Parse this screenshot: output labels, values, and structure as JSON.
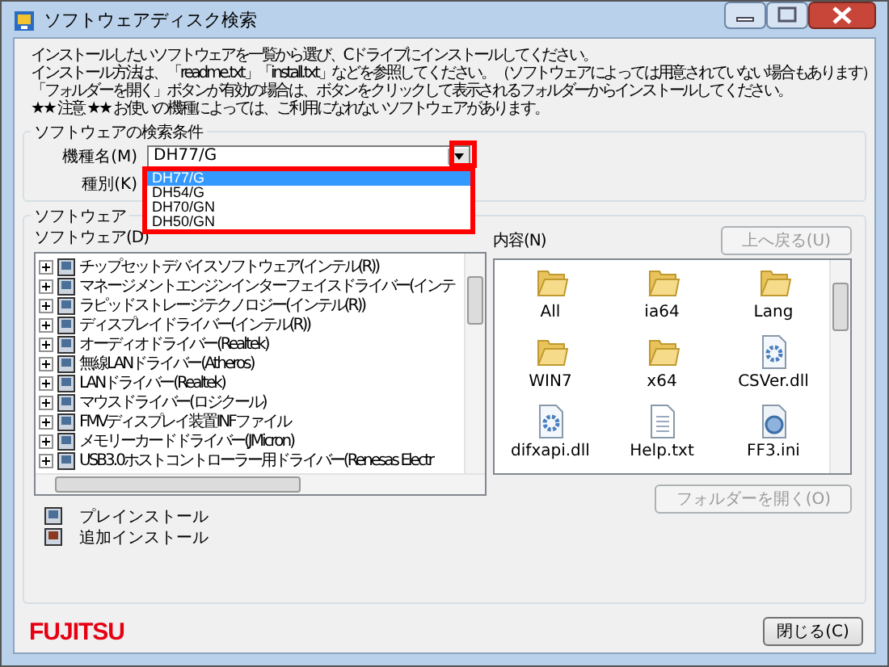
{
  "window": {
    "title": "ソフトウェアディスク検索"
  },
  "instructions": [
    "インストールしたいソフトウェアを一覧から選び、Cドライブにインストールしてください。",
    "インストール方法は、「readme.txt」「install.txt」などを参照してください。（ソフトウェアによっては用意されていない場合もあります）",
    "「フォルダーを開く」ボタンが有効の場合は、ボタンをクリックして表示されるフォルダーからインストールしてください。",
    "★★ 注意 ★★ お使いの機種によっては、ご利用になれないソフトウェアがあります。"
  ],
  "search_conditions": {
    "title": "ソフトウェアの検索条件",
    "model": {
      "label": "機種名(M)",
      "value": "DH77/G",
      "expanded": true,
      "options": [
        {
          "label": "DH77/G",
          "selected": true
        },
        {
          "label": "DH54/G",
          "selected": false
        },
        {
          "label": "DH70/GN",
          "selected": false
        },
        {
          "label": "DH50/GN",
          "selected": false
        }
      ]
    },
    "type": {
      "label": "種別(K)"
    }
  },
  "software": {
    "title": "ソフトウェア",
    "tree": {
      "label": "ソフトウェア(D)",
      "items": [
        {
          "label": "チップセットデバイスソフトウェア(インテル(R))",
          "expanded": false
        },
        {
          "label": "マネージメントエンジンインターフェイスドライバー(インテ",
          "expanded": false
        },
        {
          "label": "ラピッドストレージテクノロジー(インテル(R))",
          "expanded": false
        },
        {
          "label": "ディスプレイドライバー(インテル(R))",
          "expanded": false
        },
        {
          "label": "オーディオドライバー(Realtek)",
          "expanded": false
        },
        {
          "label": "無線LANドライバー(Atheros)",
          "expanded": false
        },
        {
          "label": "LANドライバー(Realtek)",
          "expanded": false
        },
        {
          "label": "マウスドライバー(ロジクール)",
          "expanded": false
        },
        {
          "label": "FMVディスプレイ装置INFファイル",
          "expanded": false
        },
        {
          "label": "メモリーカードドライバー(JMicron)",
          "expanded": false
        },
        {
          "label": "USB3.0ホストコントローラー用ドライバー(Renesas Electr",
          "expanded": false
        }
      ]
    },
    "legend": [
      {
        "kind": "preinstall",
        "label": "プレインストール"
      },
      {
        "kind": "additional",
        "label": "追加インストール"
      }
    ],
    "contents": {
      "label": "内容(N)",
      "up_button": {
        "label": "上へ戻る(U)",
        "disabled": true
      },
      "items": [
        {
          "name": "All",
          "kind": "folder"
        },
        {
          "name": "ia64",
          "kind": "folder"
        },
        {
          "name": "Lang",
          "kind": "folder"
        },
        {
          "name": "WIN7",
          "kind": "folder"
        },
        {
          "name": "x64",
          "kind": "folder"
        },
        {
          "name": "CSVer.dll",
          "kind": "dll"
        },
        {
          "name": "difxapi.dll",
          "kind": "dll"
        },
        {
          "name": "Help.txt",
          "kind": "text"
        },
        {
          "name": "FF3.ini",
          "kind": "ini"
        }
      ],
      "open_button": {
        "label": "フォルダーを開く(O)",
        "disabled": true
      }
    }
  },
  "footer": {
    "logo": "FUJITSU",
    "close_button": {
      "label": "閉じる(C)",
      "disabled": false
    }
  }
}
